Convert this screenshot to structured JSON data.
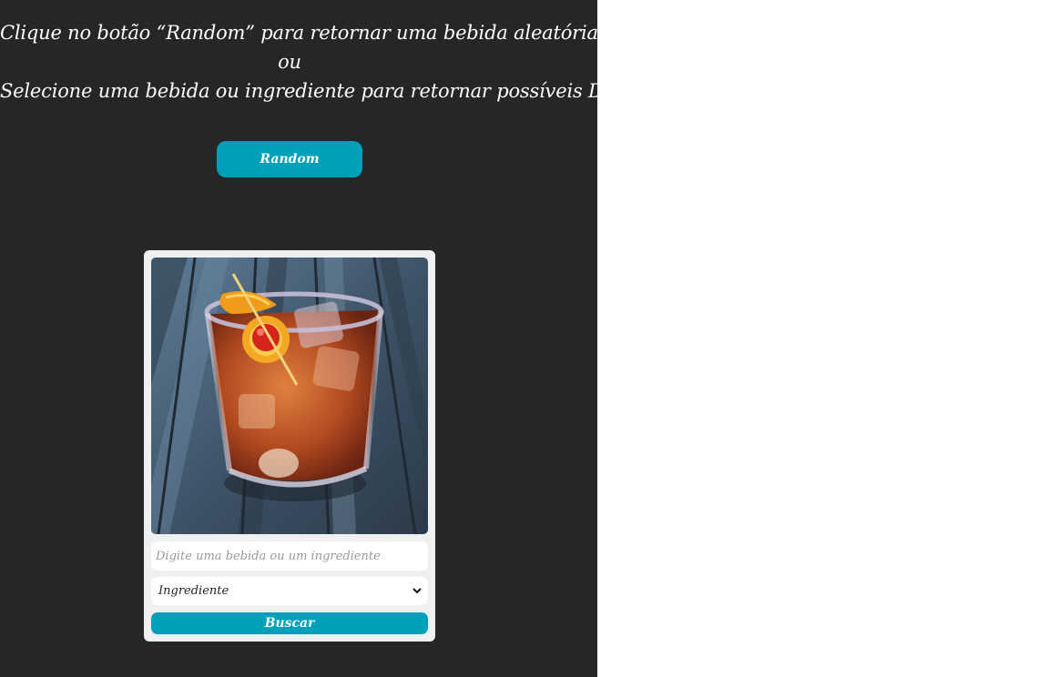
{
  "instructions": {
    "line1": "Clique no botão “Random” para retornar uma bebida aleatória.",
    "line2": "ou",
    "line3": "Selecione uma bebida ou ingrediente para retornar possíveis Drinks!"
  },
  "random_button": {
    "label": "Random"
  },
  "card": {
    "image_icon": "cocktail-photo",
    "search": {
      "placeholder": "Digite uma bebida ou um ingrediente",
      "value": ""
    },
    "select": {
      "selected": "Ingrediente"
    },
    "search_button": {
      "label": "Buscar"
    }
  },
  "colors": {
    "background": "#262626",
    "accent": "#00a0bb",
    "card": "#eef0f2"
  }
}
